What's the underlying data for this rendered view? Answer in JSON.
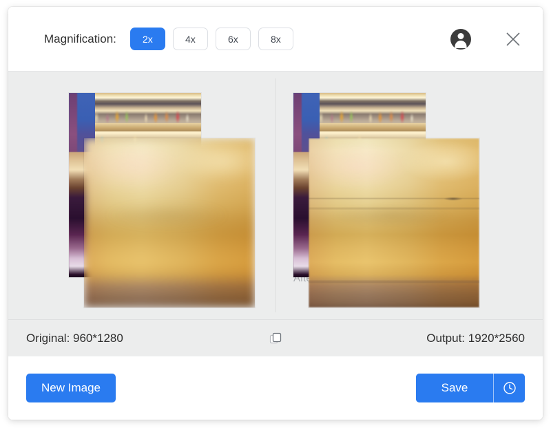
{
  "window": {
    "accent_color": "#2a7bf0",
    "background_color": "#ffffff",
    "preview_background_color": "#eceded"
  },
  "toolbar": {
    "magnification_label": "Magnification:",
    "options": [
      {
        "label": "2x",
        "selected": true
      },
      {
        "label": "4x",
        "selected": false
      },
      {
        "label": "6x",
        "selected": false
      },
      {
        "label": "8x",
        "selected": false
      }
    ],
    "avatar_icon": "user-avatar-icon",
    "close_icon": "close-icon"
  },
  "preview": {
    "panes": [
      {
        "caption": ""
      },
      {
        "caption": "After"
      }
    ],
    "divider": true
  },
  "info_bar": {
    "original_label": "Original: 960*1280",
    "output_label": "Output: 1920*2560",
    "copy_icon": "copy-icon"
  },
  "footer": {
    "new_image_label": "New Image",
    "save_label": "Save",
    "save_history_icon": "clock-icon"
  }
}
